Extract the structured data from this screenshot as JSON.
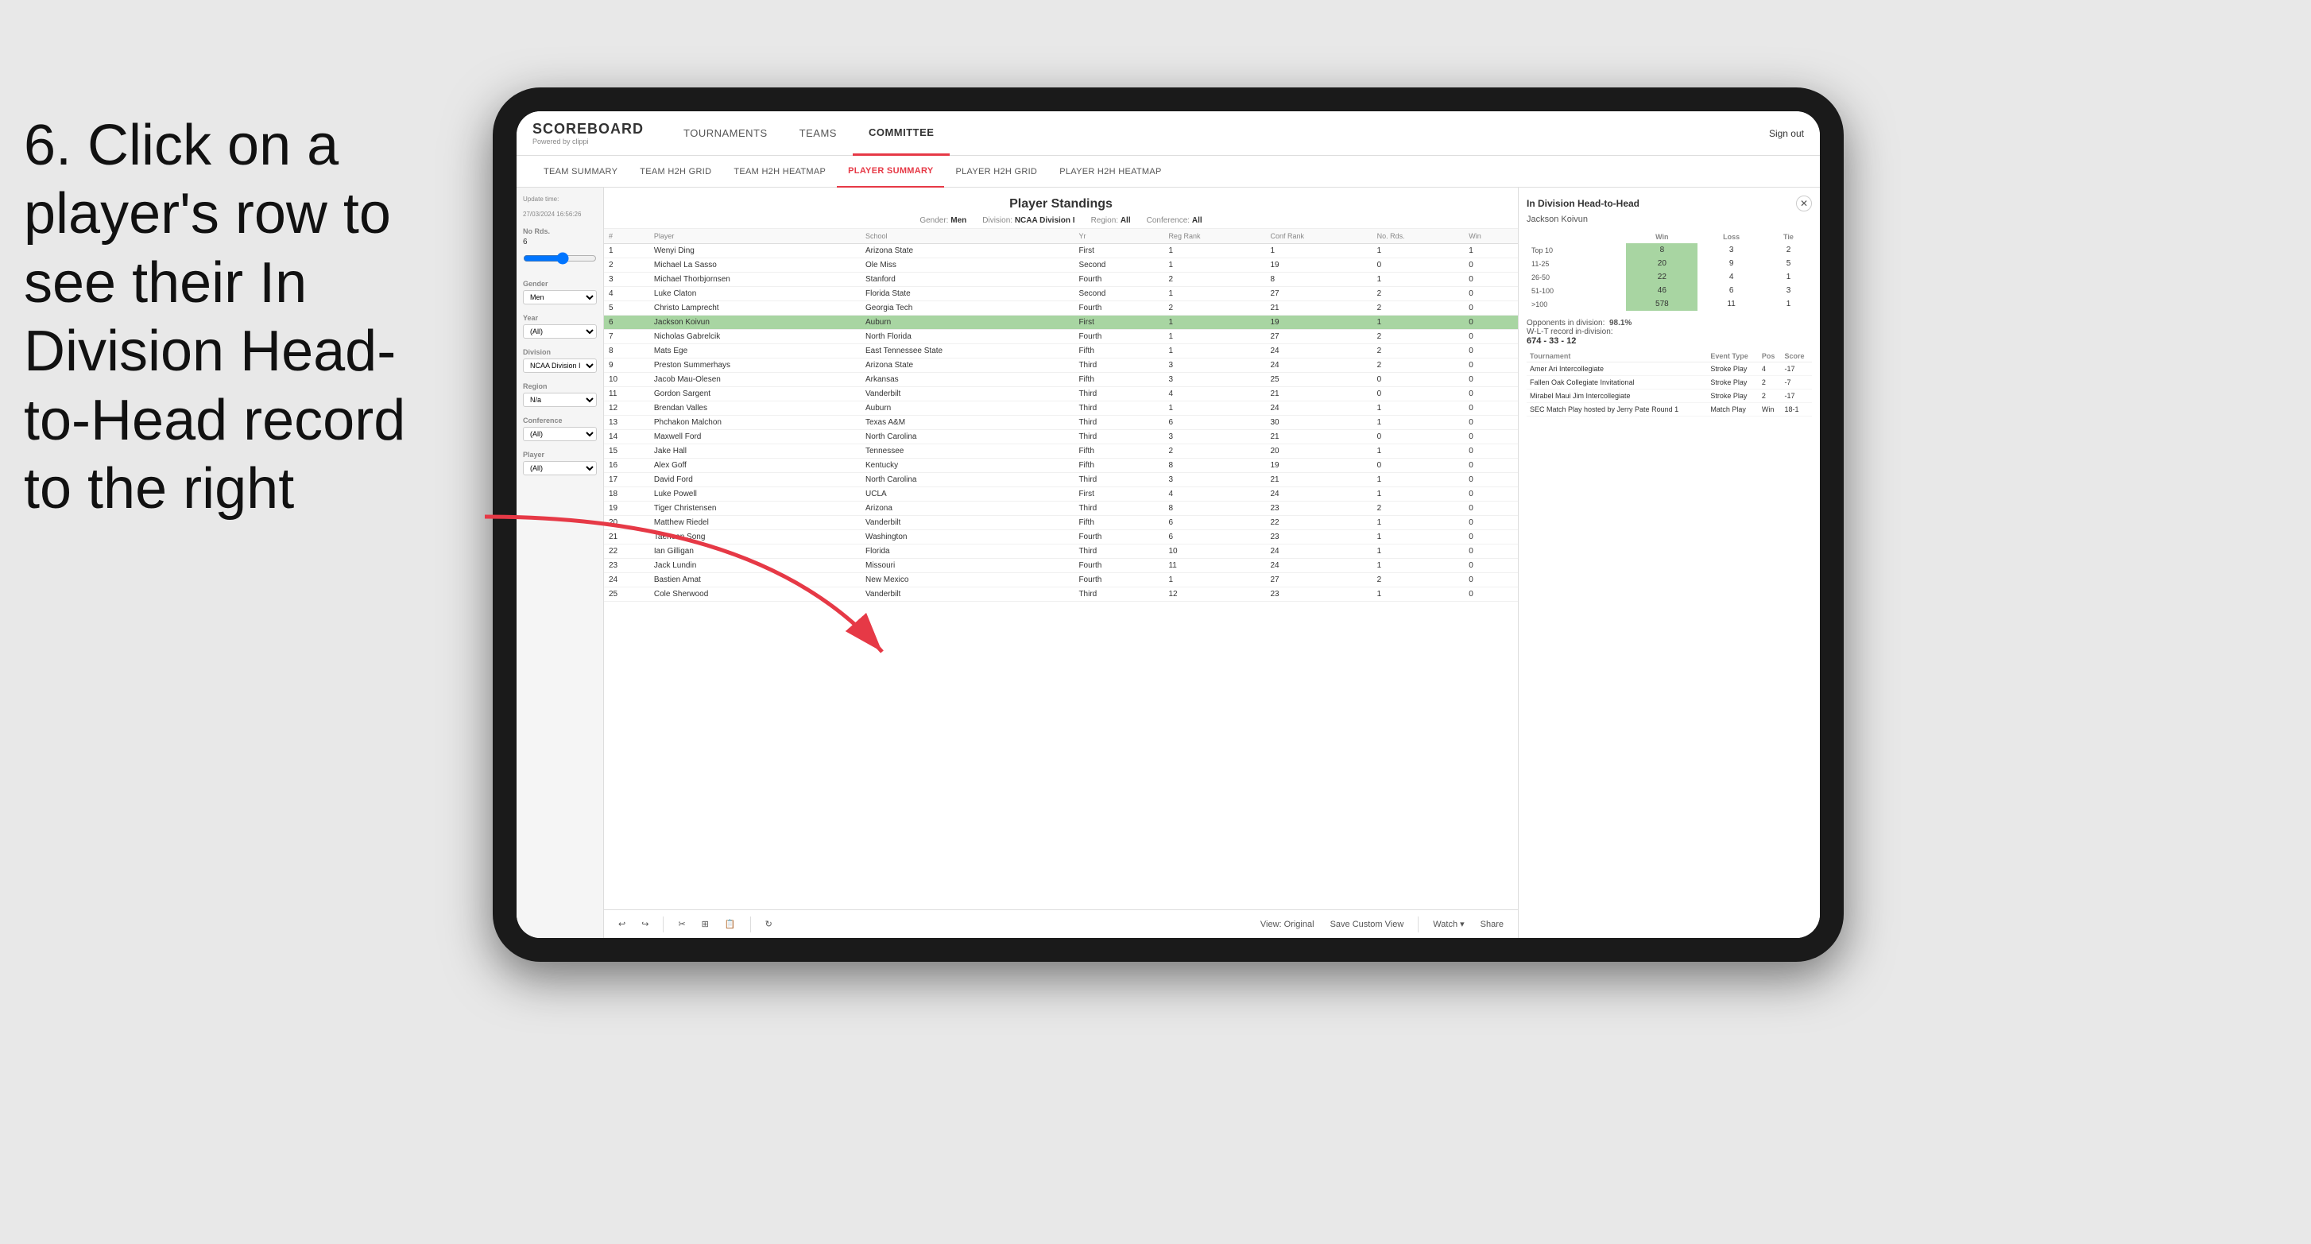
{
  "instruction": {
    "text": "6. Click on a player's row to see their In Division Head-to-Head record to the right"
  },
  "nav": {
    "logo_main": "SCOREBOARD",
    "logo_sub": "Powered by clippi",
    "links": [
      "TOURNAMENTS",
      "TEAMS",
      "COMMITTEE"
    ],
    "active_link": "COMMITTEE",
    "sign_out": "Sign out"
  },
  "sub_nav": {
    "links": [
      "TEAM SUMMARY",
      "TEAM H2H GRID",
      "TEAM H2H HEATMAP",
      "PLAYER SUMMARY",
      "PLAYER H2H GRID",
      "PLAYER H2H HEATMAP"
    ],
    "active": "PLAYER SUMMARY"
  },
  "sidebar": {
    "update_label": "Update time:",
    "update_time": "27/03/2024 16:56:26",
    "no_rds_label": "No Rds.",
    "no_rds_value": "6",
    "gender_label": "Gender",
    "gender_value": "Men",
    "year_label": "Year",
    "year_value": "(All)",
    "division_label": "Division",
    "division_value": "NCAA Division I",
    "region_label": "Region",
    "region_value": "N/a",
    "conference_label": "Conference",
    "conference_value": "(All)",
    "player_label": "Player",
    "player_value": "(All)"
  },
  "standings": {
    "title": "Player Standings",
    "gender_label": "Gender:",
    "gender_value": "Men",
    "division_label": "Division:",
    "division_value": "NCAA Division I",
    "region_label": "Region:",
    "region_value": "All",
    "conference_label": "Conference:",
    "conference_value": "All",
    "columns": [
      "#",
      "Player",
      "School",
      "Yr",
      "Reg Rank",
      "Conf Rank",
      "No. Rds.",
      "Win"
    ],
    "rows": [
      {
        "num": 1,
        "name": "Wenyi Ding",
        "school": "Arizona State",
        "yr": "First",
        "reg": 1,
        "conf": 1,
        "rds": 1,
        "win": 1
      },
      {
        "num": 2,
        "name": "Michael La Sasso",
        "school": "Ole Miss",
        "yr": "Second",
        "reg": 1,
        "conf": 19,
        "rds": 0,
        "win": 0
      },
      {
        "num": 3,
        "name": "Michael Thorbjornsen",
        "school": "Stanford",
        "yr": "Fourth",
        "reg": 2,
        "conf": 8,
        "rds": 1,
        "win": 0
      },
      {
        "num": 4,
        "name": "Luke Claton",
        "school": "Florida State",
        "yr": "Second",
        "reg": 1,
        "conf": 27,
        "rds": 2,
        "win": 0
      },
      {
        "num": 5,
        "name": "Christo Lamprecht",
        "school": "Georgia Tech",
        "yr": "Fourth",
        "reg": 2,
        "conf": 21,
        "rds": 2,
        "win": 0
      },
      {
        "num": 6,
        "name": "Jackson Koivun",
        "school": "Auburn",
        "yr": "First",
        "reg": 1,
        "conf": 19,
        "rds": 1,
        "win": 0
      },
      {
        "num": 7,
        "name": "Nicholas Gabrelcik",
        "school": "North Florida",
        "yr": "Fourth",
        "reg": 1,
        "conf": 27,
        "rds": 2,
        "win": 0
      },
      {
        "num": 8,
        "name": "Mats Ege",
        "school": "East Tennessee State",
        "yr": "Fifth",
        "reg": 1,
        "conf": 24,
        "rds": 2,
        "win": 0
      },
      {
        "num": 9,
        "name": "Preston Summerhays",
        "school": "Arizona State",
        "yr": "Third",
        "reg": 3,
        "conf": 24,
        "rds": 2,
        "win": 0
      },
      {
        "num": 10,
        "name": "Jacob Mau-Olesen",
        "school": "Arkansas",
        "yr": "Fifth",
        "reg": 3,
        "conf": 25,
        "rds": 0,
        "win": 0
      },
      {
        "num": 11,
        "name": "Gordon Sargent",
        "school": "Vanderbilt",
        "yr": "Third",
        "reg": 4,
        "conf": 21,
        "rds": 0,
        "win": 0
      },
      {
        "num": 12,
        "name": "Brendan Valles",
        "school": "Auburn",
        "yr": "Third",
        "reg": 1,
        "conf": 24,
        "rds": 1,
        "win": 0
      },
      {
        "num": 13,
        "name": "Phchakon Malchon",
        "school": "Texas A&M",
        "yr": "Third",
        "reg": 6,
        "conf": 30,
        "rds": 1,
        "win": 0
      },
      {
        "num": 14,
        "name": "Maxwell Ford",
        "school": "North Carolina",
        "yr": "Third",
        "reg": 3,
        "conf": 21,
        "rds": 0,
        "win": 0
      },
      {
        "num": 15,
        "name": "Jake Hall",
        "school": "Tennessee",
        "yr": "Fifth",
        "reg": 2,
        "conf": 20,
        "rds": 1,
        "win": 0
      },
      {
        "num": 16,
        "name": "Alex Goff",
        "school": "Kentucky",
        "yr": "Fifth",
        "reg": 8,
        "conf": 19,
        "rds": 0,
        "win": 0
      },
      {
        "num": 17,
        "name": "David Ford",
        "school": "North Carolina",
        "yr": "Third",
        "reg": 3,
        "conf": 21,
        "rds": 1,
        "win": 0
      },
      {
        "num": 18,
        "name": "Luke Powell",
        "school": "UCLA",
        "yr": "First",
        "reg": 4,
        "conf": 24,
        "rds": 1,
        "win": 0
      },
      {
        "num": 19,
        "name": "Tiger Christensen",
        "school": "Arizona",
        "yr": "Third",
        "reg": 8,
        "conf": 23,
        "rds": 2,
        "win": 0
      },
      {
        "num": 20,
        "name": "Matthew Riedel",
        "school": "Vanderbilt",
        "yr": "Fifth",
        "reg": 6,
        "conf": 22,
        "rds": 1,
        "win": 0
      },
      {
        "num": 21,
        "name": "Taehoon Song",
        "school": "Washington",
        "yr": "Fourth",
        "reg": 6,
        "conf": 23,
        "rds": 1,
        "win": 0
      },
      {
        "num": 22,
        "name": "Ian Gilligan",
        "school": "Florida",
        "yr": "Third",
        "reg": 10,
        "conf": 24,
        "rds": 1,
        "win": 0
      },
      {
        "num": 23,
        "name": "Jack Lundin",
        "school": "Missouri",
        "yr": "Fourth",
        "reg": 11,
        "conf": 24,
        "rds": 1,
        "win": 0
      },
      {
        "num": 24,
        "name": "Bastien Amat",
        "school": "New Mexico",
        "yr": "Fourth",
        "reg": 1,
        "conf": 27,
        "rds": 2,
        "win": 0
      },
      {
        "num": 25,
        "name": "Cole Sherwood",
        "school": "Vanderbilt",
        "yr": "Third",
        "reg": 12,
        "conf": 23,
        "rds": 1,
        "win": 0
      }
    ],
    "highlighted_row": 6
  },
  "h2h": {
    "title": "In Division Head-to-Head",
    "player": "Jackson Koivun",
    "grid_headers": [
      "Win",
      "Loss",
      "Tie"
    ],
    "grid_rows": [
      {
        "range": "Top 10",
        "win": 8,
        "loss": 3,
        "tie": 2
      },
      {
        "range": "11-25",
        "win": 20,
        "loss": 9,
        "tie": 5
      },
      {
        "range": "26-50",
        "win": 22,
        "loss": 4,
        "tie": 1
      },
      {
        "range": "51-100",
        "win": 46,
        "loss": 6,
        "tie": 3
      },
      {
        "range": ">100",
        "win": 578,
        "loss": 11,
        "tie": 1
      }
    ],
    "opponents_label": "Opponents in division:",
    "opponents_value": "98.1%",
    "wlt_label": "W-L-T record in-division:",
    "wlt_value": "674 - 33 - 12",
    "tournament_columns": [
      "Tournament",
      "Event Type",
      "Pos",
      "Score"
    ],
    "tournaments": [
      {
        "name": "Amer Ari Intercollegiate",
        "type": "Stroke Play",
        "pos": 4,
        "score": "-17"
      },
      {
        "name": "Fallen Oak Collegiate Invitational",
        "type": "Stroke Play",
        "pos": 2,
        "score": "-7"
      },
      {
        "name": "Mirabel Maui Jim Intercollegiate",
        "type": "Stroke Play",
        "pos": 2,
        "score": "-17"
      },
      {
        "name": "SEC Match Play hosted by Jerry Pate Round 1",
        "type": "Match Play",
        "pos": "Win",
        "score": "18-1"
      }
    ]
  },
  "toolbar": {
    "undo": "↩",
    "redo": "↪",
    "view_original": "View: Original",
    "save_custom": "Save Custom View",
    "watch": "Watch ▾",
    "share": "Share"
  }
}
